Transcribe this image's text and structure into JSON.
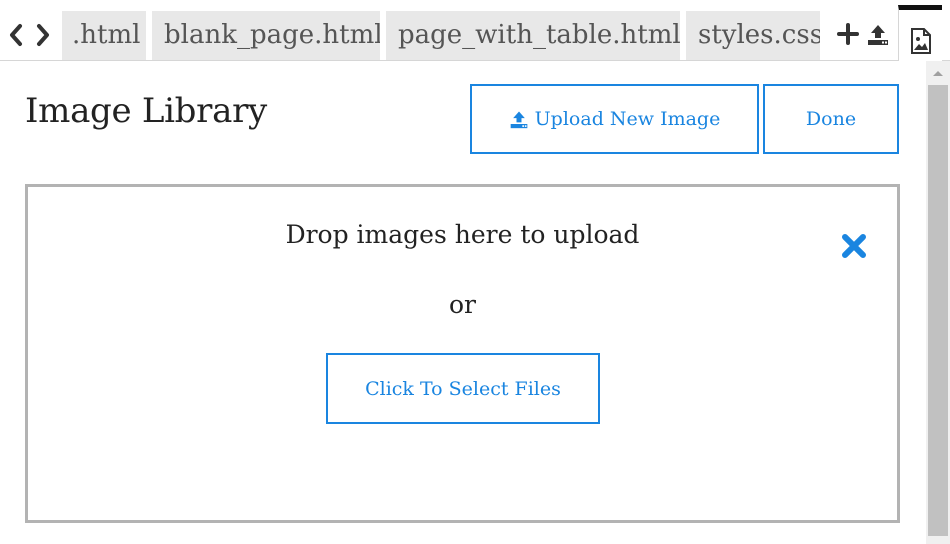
{
  "tabs": [
    {
      "label": ".html"
    },
    {
      "label": "blank_page.html"
    },
    {
      "label": "page_with_table.html"
    },
    {
      "label": "styles.css"
    }
  ],
  "icons": {
    "nav_back": "chevron-left-icon",
    "nav_forward": "chevron-right-icon",
    "add_tab": "plus-icon",
    "upload_tab": "upload-icon",
    "image_library_tab": "image-file-icon",
    "close": "close-icon"
  },
  "header": {
    "title": "Image Library",
    "upload_button": "Upload New Image",
    "done_button": "Done"
  },
  "dropzone": {
    "instruction": "Drop images here to upload",
    "or_text": "or",
    "select_button": "Click To Select Files"
  },
  "colors": {
    "accent": "#1a85e0",
    "tab_bg": "#e8e8e8",
    "dropzone_border": "#b3b3b3"
  }
}
